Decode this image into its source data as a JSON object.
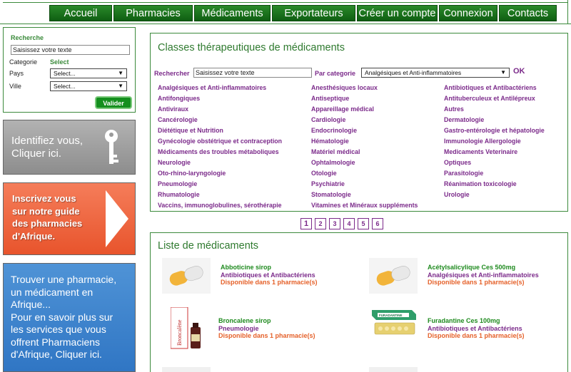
{
  "nav": [
    {
      "label": "Accueil",
      "icon": "home"
    },
    {
      "label": "Pharmacies",
      "icon": "pharmacy"
    },
    {
      "label": "Médicaments",
      "icon": "medicine"
    },
    {
      "label": "Exportateurs",
      "icon": "export"
    },
    {
      "label": "Créer un compte",
      "icon": "account"
    },
    {
      "label": "Connexion",
      "icon": "login"
    },
    {
      "label": "Contacts",
      "icon": "contacts"
    }
  ],
  "search": {
    "title": "Recherche",
    "input_value": "Saisissez votre texte",
    "category_label": "Categorie",
    "category_value": "Select",
    "country_label": "Pays",
    "country_value": "Select...",
    "city_label": "Ville",
    "city_value": "Select...",
    "submit_label": "Valider"
  },
  "promos": {
    "identify": {
      "line1": "Identifiez vous,",
      "line2": "Cliquer ici.",
      "icon": "key-icon"
    },
    "register": {
      "line1": "Inscrivez vous",
      "line2": "sur notre guide",
      "line3": "des pharmacies",
      "line4": "d'Afrique.",
      "icon": "arrow-right-icon"
    },
    "find": {
      "lines": [
        "Trouver une pharmacie,",
        "un médicament en",
        "Afrique...",
        "Pour en savoir plus sur",
        "les services que vous",
        "offrent  Pharmaciens",
        "d'Afrique, Cliquer ici."
      ]
    }
  },
  "classes": {
    "title": "Classes thérapeutiques de médicaments",
    "search_label": "Rechercher",
    "search_value": "Saisissez votre texte",
    "category_label": "Par categorie",
    "category_value": "Analgésiques et Anti-inflammatoires",
    "ok_label": "OK",
    "col1": [
      "Analgésiques et Anti-inflammatoires",
      "Antifongiques",
      "Antiviraux",
      "Cancérologie",
      "Diététique et Nutrition",
      "Gynécologie obstétrique et contraception",
      "Médicaments des troubles métaboliques",
      "Neurologie",
      "Oto-rhino-laryngologie",
      "Pneumologie",
      "Rhumatologie",
      "Vaccins, immunoglobulines, sérothérapie"
    ],
    "col2": [
      "Anesthésiques locaux",
      "Antiseptique",
      "Appareillage médical",
      "Cardiologie",
      "Endocrinologie",
      "Hématologie",
      "Matériel médical",
      "Ophtalmologie",
      "Otologie",
      "Psychiatrie",
      "Stomatologie",
      "Vitamines et Minéraux suppléments"
    ],
    "col3": [
      "Antibiotiques et Antibactériens",
      "Antituberculeux et Antilépreux",
      "Autres",
      "Dermatologie",
      "Gastro-entérologie et hépatologie",
      "Immunologie Allergologie",
      "Medicaments Veterinaire",
      "Optiques",
      "Parasitologie",
      "Réanimation toxicologie",
      "Urologie"
    ]
  },
  "pagination": [
    "1",
    "2",
    "3",
    "4",
    "5",
    "6"
  ],
  "meds": {
    "title": "Liste de médicaments",
    "items": [
      {
        "name": "Abboticine sirop",
        "category": "Antibiotiques et Antibactériens",
        "availability": "Disponible dans 1 pharmacie(s)",
        "image": "capsule-icon"
      },
      {
        "name": "Acétylsalicylique Ces 500mg",
        "category": "Analgésiques et Anti-inflammatoires",
        "availability": "Disponible dans 1 pharmacie(s)",
        "image": "capsule-icon"
      },
      {
        "name": "Broncalene sirop",
        "category": "Pneumologie",
        "availability": "Disponible dans 1 pharmacie(s)",
        "image": "syrup-bottle-icon",
        "image_text": "Broncalène"
      },
      {
        "name": "Furadantine Ces 100mg",
        "category": "Antibiotiques et Antibactériens",
        "availability": "Disponible dans 1 pharmacie(s)",
        "image": "pill-box-icon",
        "image_text": "FURADANTINE"
      }
    ]
  },
  "colors": {
    "green": "#0f5e12",
    "purple": "#7b2a8a",
    "orange": "#e5612a",
    "blue": "#3076c4"
  }
}
